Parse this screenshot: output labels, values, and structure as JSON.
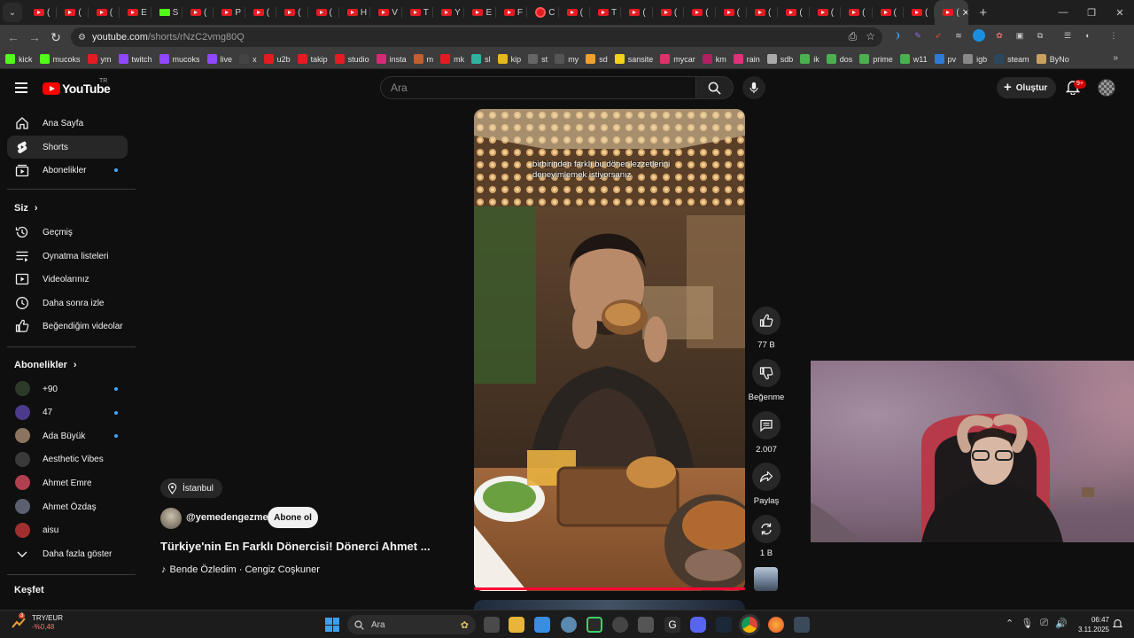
{
  "browser": {
    "tabs": [
      {
        "icon": "youtube",
        "label": "("
      },
      {
        "icon": "youtube",
        "label": "("
      },
      {
        "icon": "youtube",
        "label": "("
      },
      {
        "icon": "youtube",
        "label": "E"
      },
      {
        "icon": "kick",
        "label": "S"
      },
      {
        "icon": "youtube",
        "label": "("
      },
      {
        "icon": "youtube",
        "label": "P"
      },
      {
        "icon": "youtube",
        "label": "("
      },
      {
        "icon": "youtube",
        "label": "("
      },
      {
        "icon": "youtube",
        "label": "("
      },
      {
        "icon": "youtube",
        "label": "H"
      },
      {
        "icon": "youtube",
        "label": "V"
      },
      {
        "icon": "youtube",
        "label": "T"
      },
      {
        "icon": "youtube",
        "label": "Y"
      },
      {
        "icon": "youtube",
        "label": "E"
      },
      {
        "icon": "youtube",
        "label": "F"
      },
      {
        "icon": "ring",
        "label": "C"
      },
      {
        "icon": "youtube",
        "label": "("
      },
      {
        "icon": "youtube",
        "label": "T"
      },
      {
        "icon": "youtube",
        "label": "("
      },
      {
        "icon": "youtube",
        "label": "("
      },
      {
        "icon": "youtube",
        "label": "("
      },
      {
        "icon": "youtube",
        "label": "("
      },
      {
        "icon": "youtube",
        "label": "("
      },
      {
        "icon": "youtube",
        "label": "("
      },
      {
        "icon": "youtube",
        "label": "("
      },
      {
        "icon": "youtube",
        "label": "("
      },
      {
        "icon": "youtube",
        "label": "("
      },
      {
        "icon": "youtube",
        "label": "("
      }
    ],
    "active_tab": {
      "label": "(",
      "close": "✕"
    },
    "new_tab": "+",
    "window_controls": {
      "minimize": "—",
      "restore": "❐",
      "close": "✕"
    },
    "url_host": "youtube.com",
    "url_path": "/shorts/rNzC2vmg80Q",
    "bookmarks": [
      {
        "label": "kick",
        "color": "#53fc18"
      },
      {
        "label": "mucoks",
        "color": "#53fc18"
      },
      {
        "label": "ym",
        "color": "#e31b23"
      },
      {
        "label": "twitch",
        "color": "#9146ff"
      },
      {
        "label": "mucoks",
        "color": "#9146ff"
      },
      {
        "label": "live",
        "color": "#9146ff"
      },
      {
        "label": "x",
        "color": "#444444"
      },
      {
        "label": "u2b",
        "color": "#e31b23"
      },
      {
        "label": "takip",
        "color": "#e31b23"
      },
      {
        "label": "studio",
        "color": "#e31b23"
      },
      {
        "label": "insta",
        "color": "#d62976"
      },
      {
        "label": "m",
        "color": "#c06030"
      },
      {
        "label": "mk",
        "color": "#e31b23"
      },
      {
        "label": "sl",
        "color": "#2fb3a0"
      },
      {
        "label": "kip",
        "color": "#e8b620"
      },
      {
        "label": "st",
        "color": "#666666"
      },
      {
        "label": "my",
        "color": "#555555"
      },
      {
        "label": "sd",
        "color": "#f0a030"
      },
      {
        "label": "sansite",
        "color": "#f2d21b"
      },
      {
        "label": "mycar",
        "color": "#e0306a"
      },
      {
        "label": "km",
        "color": "#b02060"
      },
      {
        "label": "rain",
        "color": "#e0307a"
      },
      {
        "label": "sdb",
        "color": "#aaaaaa"
      },
      {
        "label": "ik",
        "color": "#4caf50"
      },
      {
        "label": "dos",
        "color": "#4caf50"
      },
      {
        "label": "prime",
        "color": "#4caf50"
      },
      {
        "label": "w11",
        "color": "#4caf50"
      },
      {
        "label": "pv",
        "color": "#2f7bd8"
      },
      {
        "label": "igb",
        "color": "#888888"
      },
      {
        "label": "steam",
        "color": "#2a475e"
      },
      {
        "label": "ByNo",
        "color": "#c8a060"
      }
    ],
    "bookmarks_more": "»"
  },
  "header": {
    "logo": "YouTube",
    "logo_region": "TR",
    "search_placeholder": "Ara",
    "create_label": "Oluştur",
    "notification_badge": "9+"
  },
  "sidebar": {
    "main": [
      {
        "label": "Ana Sayfa",
        "icon": "home-icon"
      },
      {
        "label": "Shorts",
        "icon": "shorts-icon",
        "active": true
      },
      {
        "label": "Abonelikler",
        "icon": "subscriptions-icon",
        "dot": true
      }
    ],
    "you_header": "Siz",
    "you": [
      {
        "label": "Geçmiş",
        "icon": "history-icon"
      },
      {
        "label": "Oynatma listeleri",
        "icon": "playlists-icon"
      },
      {
        "label": "Videolarınız",
        "icon": "your-videos-icon"
      },
      {
        "label": "Daha sonra izle",
        "icon": "watch-later-icon"
      },
      {
        "label": "Beğendiğim videolar",
        "icon": "liked-videos-icon"
      }
    ],
    "subs_header": "Abonelikler",
    "subs": [
      {
        "label": "+90",
        "dot": true,
        "color": "#2d3a2a"
      },
      {
        "label": "47",
        "dot": true,
        "color": "#4b3b8a"
      },
      {
        "label": "Ada Büyük",
        "dot": true,
        "color": "#8a7460"
      },
      {
        "label": "Aesthetic Vibes",
        "dot": false,
        "color": "#3a3a3a"
      },
      {
        "label": "Ahmet Emre",
        "dot": false,
        "color": "#b04050"
      },
      {
        "label": "Ahmet Özdaş",
        "dot": false,
        "color": "#5a6070"
      },
      {
        "label": "aisu",
        "dot": false,
        "color": "#a03030"
      }
    ],
    "show_more": "Daha fazla göster",
    "explore_header": "Keşfet"
  },
  "short": {
    "location": "İstanbul",
    "channel": "@yemedengezme",
    "subscribe": "Abone ol",
    "title": "Türkiye'nin En Farklı Dönercisi! Dönerci Ahmet ...",
    "music": "Bende Özledim · Cengiz Coşkuner",
    "caption_line1": "birbirinden farklı bu döner lezzetlerini",
    "caption_line2": "deneyimlemek istiyorsanız",
    "actions": {
      "likes": "77 B",
      "dislike": "Beğenme",
      "comments": "2.007",
      "share": "Paylaş",
      "remix": "1 B"
    }
  },
  "taskbar": {
    "currency": "TRY/EUR",
    "currency_change": "-%0,48",
    "currency_badge": "3",
    "search": "Ara",
    "time": "06:47",
    "date": "3.11.2025"
  }
}
